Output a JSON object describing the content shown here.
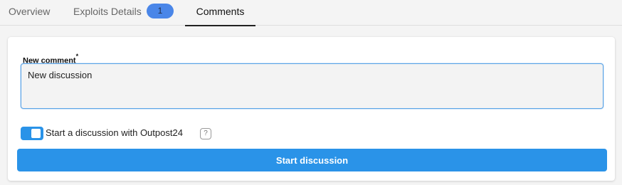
{
  "tabs": {
    "overview": "Overview",
    "exploits": "Exploits Details",
    "exploits_count": "1",
    "comments": "Comments",
    "active": "Comments"
  },
  "form": {
    "label": "New comment",
    "required_mark": "*",
    "comment_value": "New discussion",
    "toggle_label": "Start a discussion with Outpost24",
    "toggle_on": true,
    "help_icon": "?",
    "submit_label": "Start discussion"
  },
  "colors": {
    "accent": "#2a93e8",
    "badge": "#4a86e8"
  }
}
